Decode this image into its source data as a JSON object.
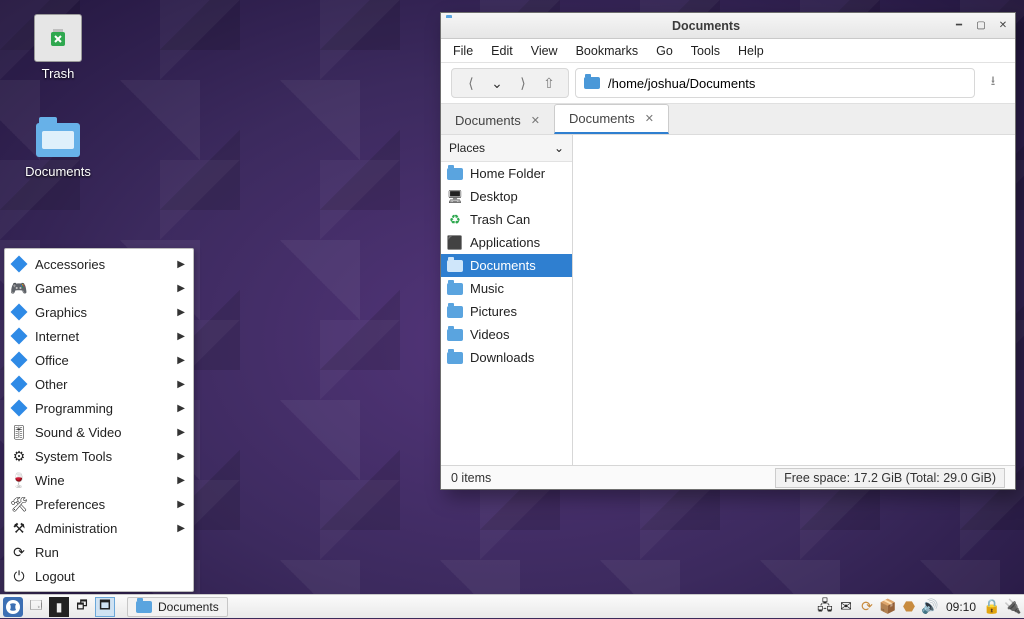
{
  "desktop": {
    "trash_label": "Trash",
    "documents_label": "Documents"
  },
  "app_menu": {
    "items": [
      {
        "label": "Accessories",
        "icon": "diamond",
        "sub": true
      },
      {
        "label": "Games",
        "icon": "games",
        "sub": true
      },
      {
        "label": "Graphics",
        "icon": "diamond",
        "sub": true
      },
      {
        "label": "Internet",
        "icon": "diamond",
        "sub": true
      },
      {
        "label": "Office",
        "icon": "diamond",
        "sub": true
      },
      {
        "label": "Other",
        "icon": "diamond",
        "sub": true
      },
      {
        "label": "Programming",
        "icon": "diamond",
        "sub": true
      },
      {
        "label": "Sound & Video",
        "icon": "sound",
        "sub": true
      },
      {
        "label": "System Tools",
        "icon": "gear",
        "sub": true
      },
      {
        "label": "Wine",
        "icon": "wine",
        "sub": true
      },
      {
        "label": "Preferences",
        "icon": "sliders",
        "sub": true
      },
      {
        "label": "Administration",
        "icon": "admin",
        "sub": true
      },
      {
        "label": "Run",
        "icon": "run",
        "sub": false
      },
      {
        "label": "Logout",
        "icon": "logout",
        "sub": false
      }
    ]
  },
  "panel": {
    "task_label": "Documents",
    "clock": "09:10"
  },
  "fm": {
    "title": "Documents",
    "menus": [
      "File",
      "Edit",
      "View",
      "Bookmarks",
      "Go",
      "Tools",
      "Help"
    ],
    "path": "/home/joshua/Documents",
    "tabs": [
      {
        "label": "Documents",
        "active": false
      },
      {
        "label": "Documents",
        "active": true
      }
    ],
    "sidebar_header": "Places",
    "places": [
      {
        "label": "Home Folder",
        "icon": "home"
      },
      {
        "label": "Desktop",
        "icon": "desktop"
      },
      {
        "label": "Trash Can",
        "icon": "trash"
      },
      {
        "label": "Applications",
        "icon": "apps"
      },
      {
        "label": "Documents",
        "icon": "folder",
        "selected": true
      },
      {
        "label": "Music",
        "icon": "folder"
      },
      {
        "label": "Pictures",
        "icon": "folder"
      },
      {
        "label": "Videos",
        "icon": "folder"
      },
      {
        "label": "Downloads",
        "icon": "folder"
      }
    ],
    "status_items": "0 items",
    "free_space": "Free space: 17.2 GiB (Total: 29.0 GiB)"
  }
}
